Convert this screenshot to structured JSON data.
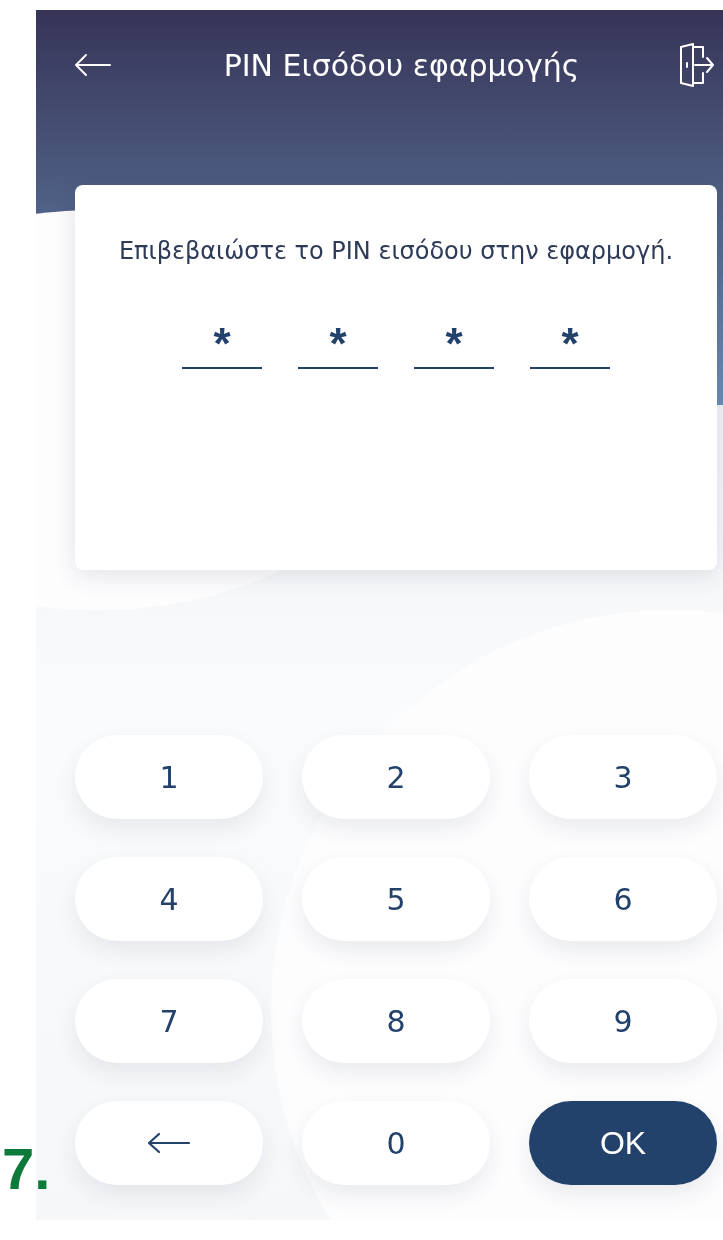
{
  "step_marker": "7.",
  "header": {
    "title": "PIN Εισόδου εφαρμογής"
  },
  "card": {
    "message": "Επιβεβαιώστε το PIN εισόδου στην εφαρμογή.",
    "pin_digits": [
      "*",
      "*",
      "*",
      "*"
    ]
  },
  "keypad": [
    {
      "kind": "digit",
      "label": "1"
    },
    {
      "kind": "digit",
      "label": "2"
    },
    {
      "kind": "digit",
      "label": "3"
    },
    {
      "kind": "digit",
      "label": "4"
    },
    {
      "kind": "digit",
      "label": "5"
    },
    {
      "kind": "digit",
      "label": "6"
    },
    {
      "kind": "digit",
      "label": "7"
    },
    {
      "kind": "digit",
      "label": "8"
    },
    {
      "kind": "digit",
      "label": "9"
    },
    {
      "kind": "backspace"
    },
    {
      "kind": "digit",
      "label": "0"
    },
    {
      "kind": "confirm",
      "label": "OK"
    }
  ]
}
